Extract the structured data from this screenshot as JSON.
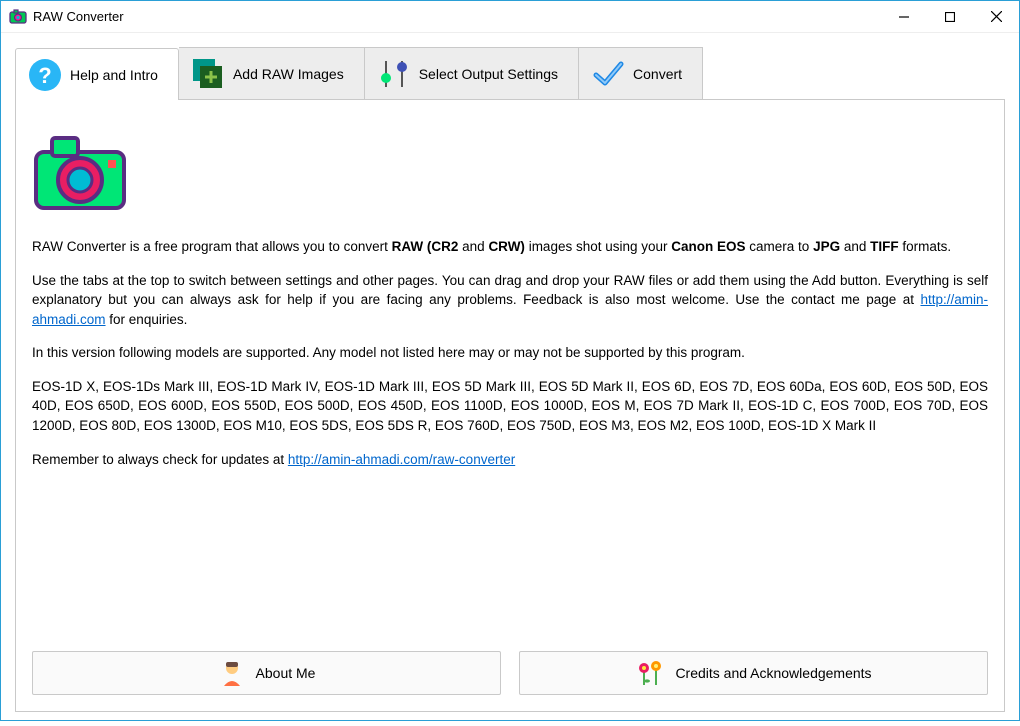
{
  "window": {
    "title": "RAW Converter"
  },
  "tabs": {
    "help": "Help and Intro",
    "add": "Add RAW Images",
    "output": "Select Output Settings",
    "convert": "Convert"
  },
  "intro": {
    "p1a": "RAW Converter is a free program that allows you to convert ",
    "p1b": "RAW (CR2",
    "p1c": " and ",
    "p1d": "CRW)",
    "p1e": " images shot using your ",
    "p1f": "Canon EOS",
    "p1g": " camera to ",
    "p1h": "JPG",
    "p1i": " and ",
    "p1j": "TIFF",
    "p1k": " formats.",
    "p2a": "Use the tabs at the top to switch between settings and other pages. You can drag and drop your RAW files or add them using the Add button. Everything is self explanatory but you can always ask for help if you are facing any problems. Feedback is also most welcome. Use the contact me page at ",
    "p2link": "http://amin-ahmadi.com",
    "p2b": " for enquiries.",
    "p3": "In this version following models are supported. Any model not listed here may or may not be supported by this program.",
    "p4": "EOS-1D X, EOS-1Ds Mark III, EOS-1D Mark IV, EOS-1D Mark III, EOS 5D Mark III, EOS 5D Mark II, EOS 6D, EOS 7D, EOS 60Da, EOS 60D, EOS 50D, EOS 40D, EOS 650D, EOS 600D, EOS 550D, EOS 500D, EOS 450D, EOS 1100D, EOS 1000D, EOS M, EOS 7D Mark II, EOS-1D C, EOS 700D, EOS 70D, EOS 1200D, EOS 80D, EOS 1300D, EOS M10, EOS 5DS, EOS 5DS R, EOS 760D, EOS 750D, EOS M3, EOS M2, EOS 100D, EOS-1D X Mark II",
    "p5a": "Remember to always check for updates at ",
    "p5link": "http://amin-ahmadi.com/raw-converter"
  },
  "buttons": {
    "about": "About Me",
    "credits": "Credits and Acknowledgements"
  }
}
